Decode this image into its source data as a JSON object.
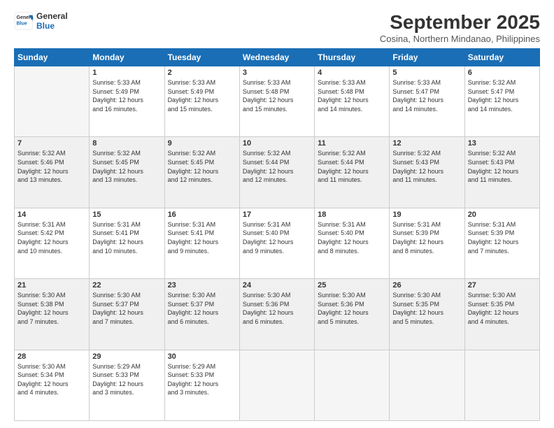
{
  "logo": {
    "line1": "General",
    "line2": "Blue"
  },
  "title": "September 2025",
  "subtitle": "Cosina, Northern Mindanao, Philippines",
  "headers": [
    "Sunday",
    "Monday",
    "Tuesday",
    "Wednesday",
    "Thursday",
    "Friday",
    "Saturday"
  ],
  "weeks": [
    [
      {
        "day": "",
        "info": ""
      },
      {
        "day": "1",
        "info": "Sunrise: 5:33 AM\nSunset: 5:49 PM\nDaylight: 12 hours\nand 16 minutes."
      },
      {
        "day": "2",
        "info": "Sunrise: 5:33 AM\nSunset: 5:49 PM\nDaylight: 12 hours\nand 15 minutes."
      },
      {
        "day": "3",
        "info": "Sunrise: 5:33 AM\nSunset: 5:48 PM\nDaylight: 12 hours\nand 15 minutes."
      },
      {
        "day": "4",
        "info": "Sunrise: 5:33 AM\nSunset: 5:48 PM\nDaylight: 12 hours\nand 14 minutes."
      },
      {
        "day": "5",
        "info": "Sunrise: 5:33 AM\nSunset: 5:47 PM\nDaylight: 12 hours\nand 14 minutes."
      },
      {
        "day": "6",
        "info": "Sunrise: 5:32 AM\nSunset: 5:47 PM\nDaylight: 12 hours\nand 14 minutes."
      }
    ],
    [
      {
        "day": "7",
        "info": "Sunrise: 5:32 AM\nSunset: 5:46 PM\nDaylight: 12 hours\nand 13 minutes."
      },
      {
        "day": "8",
        "info": "Sunrise: 5:32 AM\nSunset: 5:45 PM\nDaylight: 12 hours\nand 13 minutes."
      },
      {
        "day": "9",
        "info": "Sunrise: 5:32 AM\nSunset: 5:45 PM\nDaylight: 12 hours\nand 12 minutes."
      },
      {
        "day": "10",
        "info": "Sunrise: 5:32 AM\nSunset: 5:44 PM\nDaylight: 12 hours\nand 12 minutes."
      },
      {
        "day": "11",
        "info": "Sunrise: 5:32 AM\nSunset: 5:44 PM\nDaylight: 12 hours\nand 11 minutes."
      },
      {
        "day": "12",
        "info": "Sunrise: 5:32 AM\nSunset: 5:43 PM\nDaylight: 12 hours\nand 11 minutes."
      },
      {
        "day": "13",
        "info": "Sunrise: 5:32 AM\nSunset: 5:43 PM\nDaylight: 12 hours\nand 11 minutes."
      }
    ],
    [
      {
        "day": "14",
        "info": "Sunrise: 5:31 AM\nSunset: 5:42 PM\nDaylight: 12 hours\nand 10 minutes."
      },
      {
        "day": "15",
        "info": "Sunrise: 5:31 AM\nSunset: 5:41 PM\nDaylight: 12 hours\nand 10 minutes."
      },
      {
        "day": "16",
        "info": "Sunrise: 5:31 AM\nSunset: 5:41 PM\nDaylight: 12 hours\nand 9 minutes."
      },
      {
        "day": "17",
        "info": "Sunrise: 5:31 AM\nSunset: 5:40 PM\nDaylight: 12 hours\nand 9 minutes."
      },
      {
        "day": "18",
        "info": "Sunrise: 5:31 AM\nSunset: 5:40 PM\nDaylight: 12 hours\nand 8 minutes."
      },
      {
        "day": "19",
        "info": "Sunrise: 5:31 AM\nSunset: 5:39 PM\nDaylight: 12 hours\nand 8 minutes."
      },
      {
        "day": "20",
        "info": "Sunrise: 5:31 AM\nSunset: 5:39 PM\nDaylight: 12 hours\nand 7 minutes."
      }
    ],
    [
      {
        "day": "21",
        "info": "Sunrise: 5:30 AM\nSunset: 5:38 PM\nDaylight: 12 hours\nand 7 minutes."
      },
      {
        "day": "22",
        "info": "Sunrise: 5:30 AM\nSunset: 5:37 PM\nDaylight: 12 hours\nand 7 minutes."
      },
      {
        "day": "23",
        "info": "Sunrise: 5:30 AM\nSunset: 5:37 PM\nDaylight: 12 hours\nand 6 minutes."
      },
      {
        "day": "24",
        "info": "Sunrise: 5:30 AM\nSunset: 5:36 PM\nDaylight: 12 hours\nand 6 minutes."
      },
      {
        "day": "25",
        "info": "Sunrise: 5:30 AM\nSunset: 5:36 PM\nDaylight: 12 hours\nand 5 minutes."
      },
      {
        "day": "26",
        "info": "Sunrise: 5:30 AM\nSunset: 5:35 PM\nDaylight: 12 hours\nand 5 minutes."
      },
      {
        "day": "27",
        "info": "Sunrise: 5:30 AM\nSunset: 5:35 PM\nDaylight: 12 hours\nand 4 minutes."
      }
    ],
    [
      {
        "day": "28",
        "info": "Sunrise: 5:30 AM\nSunset: 5:34 PM\nDaylight: 12 hours\nand 4 minutes."
      },
      {
        "day": "29",
        "info": "Sunrise: 5:29 AM\nSunset: 5:33 PM\nDaylight: 12 hours\nand 3 minutes."
      },
      {
        "day": "30",
        "info": "Sunrise: 5:29 AM\nSunset: 5:33 PM\nDaylight: 12 hours\nand 3 minutes."
      },
      {
        "day": "",
        "info": ""
      },
      {
        "day": "",
        "info": ""
      },
      {
        "day": "",
        "info": ""
      },
      {
        "day": "",
        "info": ""
      }
    ]
  ]
}
